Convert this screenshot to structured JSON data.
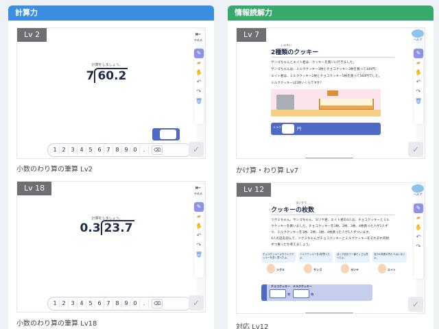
{
  "columns": {
    "left": {
      "title": "計算力",
      "cards": [
        {
          "level": "Lv 2",
          "instruction": "計算をしましょう。",
          "divisor": "7",
          "dividend": "60.2",
          "caption": "小数のわり算の筆算 Lv2"
        },
        {
          "level": "Lv 18",
          "instruction": "計算をしましょう。",
          "divisor": "0.3",
          "dividend": "23.7",
          "caption": "小数のわり算の筆算 Lv18"
        }
      ]
    },
    "right": {
      "title": "情報読解力",
      "cards": [
        {
          "level": "Lv 7",
          "title": "2種類のクッキー",
          "title_ruby": "しゅるい",
          "lines": [
            "サンゴちゃんとエイト君は、クッキーを買いに行きました。",
            "サンゴちゃんは、ミルククッキー1枚とチョコクッキー2枚を買って340円、",
            "エイト君は、ミルククッキー2枚とチョコクッキー5枚を買って560円でした。",
            "ミルククッキーは1枚いくらですか？"
          ],
          "answer_tag": "ミルク",
          "unit": "円",
          "caption": "かけ算・わり算 Lv7"
        },
        {
          "level": "Lv 12",
          "title": "クッキーの枚数",
          "title_ruby": "まいすう",
          "lines": [
            "ツグミちゃん、サンゴちゃん、ヨツヤ君、エイト君の4人は、チョコクッキーとミル",
            "ククッキーを買いました。チョコクッキーを1枚、2枚、3枚、4枚買った人が1人ず",
            "つ、ミルククッキーを1枚、2枚、3枚、4枚買った人が1人ずついます。",
            "4人の話を読んで、ツグミちゃんがチョコクッキーとミルククッキーをそれぞれ何枚",
            "ずつ買ったか考えましょう。"
          ],
          "characters": [
            {
              "talk": "チョコクッキーよりミルククッキーを多く買ったよ。",
              "name": "ツグミ"
            },
            {
              "talk": "ミルククッキーを4枚買ったよ。",
              "name": "サンゴ"
            },
            {
              "talk": "ぼくが合計で一番たくさん買ったよ。",
              "name": "ヨツヤ"
            },
            {
              "talk": "自分の枚数が同じ人はいないよ。",
              "name": "エイト"
            }
          ],
          "choco_label": "チョコクッキー",
          "milk_label": "ミルククッキー",
          "unit": "枚",
          "caption": "対応 Lv12"
        }
      ]
    }
  },
  "keypad": [
    "1",
    "2",
    "3",
    "4",
    "5",
    "6",
    "7",
    "8",
    "9",
    "0",
    "."
  ],
  "keypad_delete": "⌫",
  "toolbar": {
    "exit_label": "やめる",
    "help_label": "ヘルプ",
    "icons": [
      "pen-icon",
      "eraser-icon",
      "hand-icon",
      "undo-icon",
      "redo-icon",
      "trash-icon"
    ]
  },
  "colors": {
    "calc_header": "#3b8ee0",
    "reading_header": "#38a96c",
    "accent": "#4f69c6"
  }
}
